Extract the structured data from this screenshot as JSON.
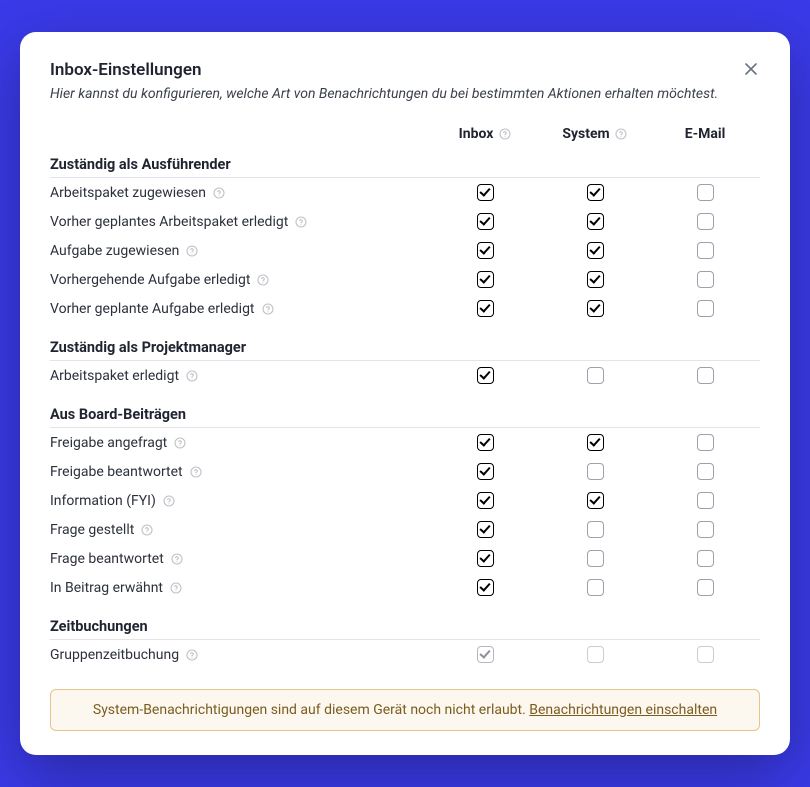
{
  "modal": {
    "title": "Inbox-Einstellungen",
    "subtitle": "Hier kannst du konfigurieren, welche Art von Benachrichtungen du bei bestimmten Aktionen erhalten möchtest."
  },
  "columns": {
    "inbox": "Inbox",
    "system": "System",
    "email": "E-Mail"
  },
  "sections": [
    {
      "title": "Zuständig als Ausführender",
      "rows": [
        {
          "label": "Arbeitspaket zugewiesen",
          "inbox": true,
          "system": true,
          "email": false
        },
        {
          "label": "Vorher geplantes Arbeitspaket erledigt",
          "inbox": true,
          "system": true,
          "email": false
        },
        {
          "label": "Aufgabe zugewiesen",
          "inbox": true,
          "system": true,
          "email": false
        },
        {
          "label": "Vorhergehende Aufgabe erledigt",
          "inbox": true,
          "system": true,
          "email": false
        },
        {
          "label": "Vorher geplante Aufgabe erledigt",
          "inbox": true,
          "system": true,
          "email": false
        }
      ]
    },
    {
      "title": "Zuständig als Projektmanager",
      "rows": [
        {
          "label": "Arbeitspaket erledigt",
          "inbox": true,
          "system": false,
          "email": false
        }
      ]
    },
    {
      "title": "Aus Board-Beiträgen",
      "rows": [
        {
          "label": "Freigabe angefragt",
          "inbox": true,
          "system": true,
          "email": false
        },
        {
          "label": "Freigabe beantwortet",
          "inbox": true,
          "system": false,
          "email": false
        },
        {
          "label": "Information (FYI)",
          "inbox": true,
          "system": true,
          "email": false
        },
        {
          "label": "Frage gestellt",
          "inbox": true,
          "system": false,
          "email": false
        },
        {
          "label": "Frage beantwortet",
          "inbox": true,
          "system": false,
          "email": false
        },
        {
          "label": "In Beitrag erwähnt",
          "inbox": true,
          "system": false,
          "email": false
        }
      ]
    },
    {
      "title": "Zeitbuchungen",
      "rows": [
        {
          "label": "Gruppenzeitbuchung",
          "inbox": true,
          "system": false,
          "email": false,
          "disabled": true
        }
      ]
    }
  ],
  "banner": {
    "text": "System-Benachrichtigungen sind auf diesem Gerät noch nicht erlaubt. ",
    "link": "Benachrichtungen einschalten"
  }
}
